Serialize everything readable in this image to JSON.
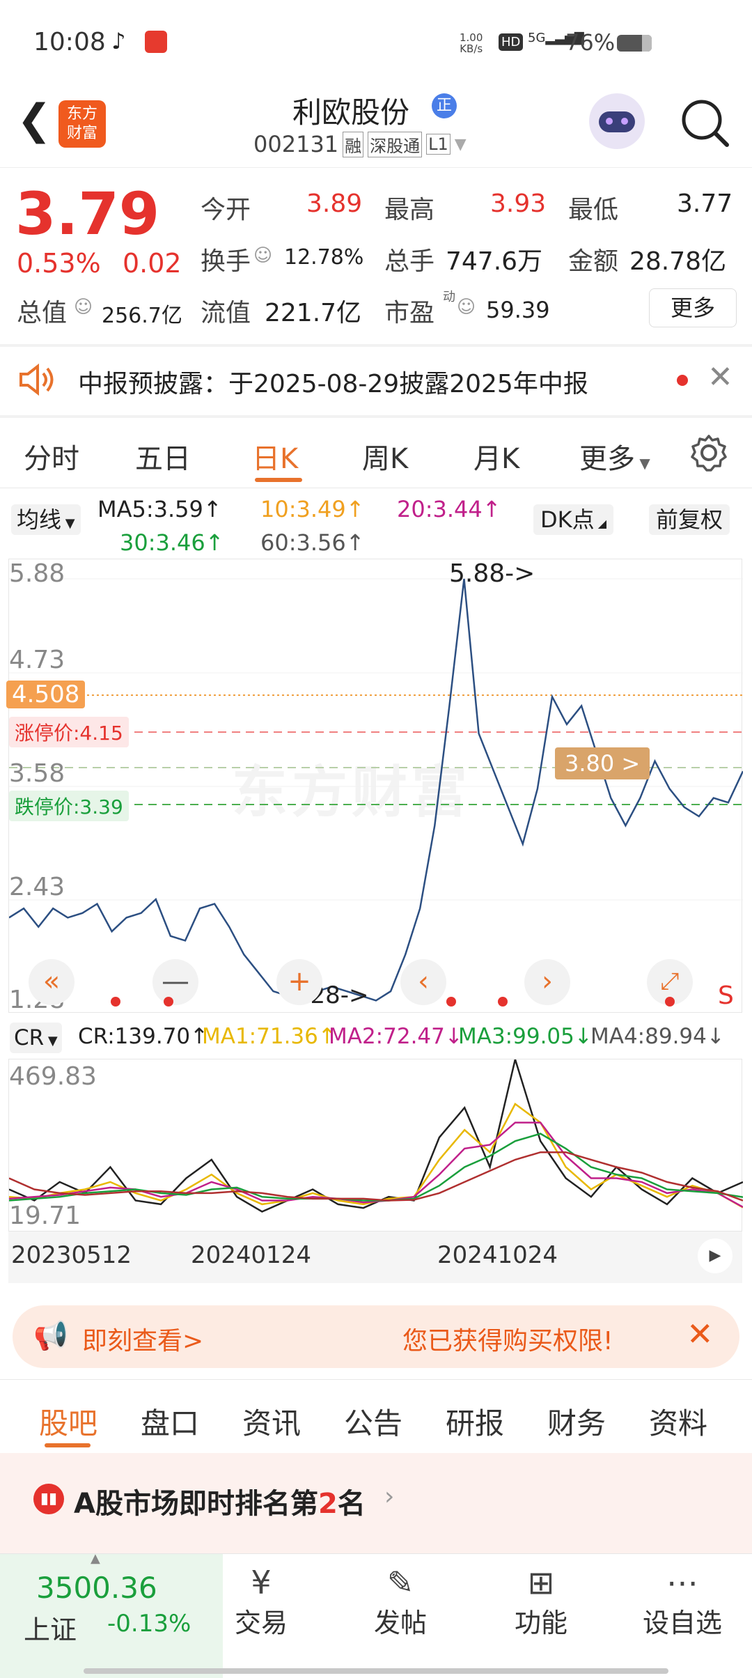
{
  "status": {
    "time": "10:08",
    "net_speed": "1.00",
    "net_unit": "KB/s",
    "hd": "HD",
    "signal": "5G",
    "battery": "76%"
  },
  "header": {
    "logo_line1": "东方",
    "logo_line2": "财富",
    "stock_name": "利欧股份",
    "badge": "正",
    "stock_code": "002131",
    "tag1": "融",
    "tag2": "深股通",
    "tag3": "L1"
  },
  "quote": {
    "price": "3.79",
    "change_pct": "0.53%",
    "change_abs": "0.02",
    "open_label": "今开",
    "open": "3.89",
    "high_label": "最高",
    "high": "3.93",
    "low_label": "最低",
    "low": "3.77",
    "turnover_label": "换手",
    "turnover": "12.78%",
    "volume_label": "总手",
    "volume": "747.6万",
    "amount_label": "金额",
    "amount": "28.78亿",
    "mktcap_label": "总值",
    "mktcap": "256.7亿",
    "float_label": "流值",
    "float": "221.7亿",
    "pe_label": "市盈",
    "pe_sup": "动",
    "pe": "59.39",
    "more": "更多"
  },
  "notice": {
    "text": "中报预披露：于2025-08-29披露2025年中报"
  },
  "tabs": [
    "分时",
    "五日",
    "日K",
    "周K",
    "月K",
    "更多"
  ],
  "ma": {
    "selector": "均线",
    "ma5": "MA5:3.59↑",
    "ma10": "10:3.49↑",
    "ma20": "20:3.44↑",
    "ma30": "30:3.46↑",
    "ma60": "60:3.56↑",
    "dk": "DK点",
    "fq": "前复权"
  },
  "kchart": {
    "y_labels": [
      "5.88",
      "4.73",
      "3.58",
      "2.43",
      "1.28"
    ],
    "max_label": "5.88->",
    "min_label": "1.28->",
    "s_mark": "S",
    "line_4508": "4.508",
    "limit_up": "涨停价:4.15",
    "limit_down": "跌停价:3.39",
    "cursor": "3.80 >",
    "watermark": "东方财富"
  },
  "chart_data": [
    {
      "type": "line",
      "title": "",
      "ylim": [
        1.28,
        5.88
      ],
      "x": [
        "20230512",
        "20240124",
        "20241024"
      ],
      "series": [
        {
          "values": [
            2.2,
            2.3,
            2.1,
            2.3,
            2.2,
            2.25,
            2.35,
            2.05,
            2.2,
            2.25,
            2.4,
            2.0,
            1.95,
            2.3,
            2.35,
            2.1,
            1.8,
            1.6,
            1.4,
            1.35,
            1.3,
            1.4,
            1.45,
            1.4,
            1.35,
            1.3,
            1.4,
            1.8,
            2.3,
            3.2,
            4.5,
            5.88,
            4.2,
            3.8,
            3.4,
            3.0,
            3.6,
            4.6,
            4.3,
            4.5,
            4.0,
            3.5,
            3.2,
            3.5,
            3.9,
            3.6,
            3.4,
            3.3,
            3.5,
            3.45,
            3.79
          ]
        }
      ]
    },
    {
      "type": "line",
      "title": "",
      "ylim": [
        19.71,
        469.83
      ],
      "series": [
        {
          "name": "CR",
          "values": [
            120,
            90,
            140,
            110,
            180,
            90,
            80,
            150,
            200,
            100,
            60,
            90,
            120,
            80,
            70,
            100,
            90,
            260,
            340,
            180,
            470,
            250,
            150,
            100,
            180,
            120,
            80,
            150,
            110,
            139.7
          ]
        },
        {
          "name": "MA1",
          "values": [
            100,
            95,
            110,
            120,
            140,
            110,
            90,
            120,
            160,
            110,
            80,
            90,
            110,
            90,
            80,
            95,
            100,
            200,
            280,
            220,
            350,
            300,
            180,
            120,
            160,
            130,
            100,
            130,
            110,
            71.36
          ]
        },
        {
          "name": "MA2",
          "values": [
            95,
            100,
            105,
            115,
            125,
            120,
            100,
            110,
            140,
            120,
            90,
            90,
            100,
            95,
            85,
            90,
            100,
            160,
            230,
            240,
            300,
            300,
            210,
            150,
            150,
            140,
            110,
            120,
            110,
            72.47
          ]
        },
        {
          "name": "MA3",
          "values": [
            90,
            95,
            100,
            110,
            115,
            120,
            110,
            105,
            120,
            125,
            100,
            95,
            95,
            95,
            90,
            90,
            95,
            130,
            180,
            210,
            250,
            270,
            230,
            180,
            160,
            150,
            120,
            115,
            110,
            99.05
          ]
        },
        {
          "name": "MA4",
          "values": [
            150,
            120,
            110,
            105,
            110,
            115,
            115,
            110,
            110,
            115,
            110,
            100,
            95,
            95,
            95,
            90,
            92,
            110,
            140,
            170,
            200,
            220,
            220,
            200,
            180,
            165,
            140,
            125,
            115,
            89.94
          ]
        }
      ]
    }
  ],
  "cr": {
    "selector": "CR",
    "cr": "CR:139.70↑",
    "ma1": "MA1:71.36↑",
    "ma2": "MA2:72.47↓",
    "ma3": "MA3:99.05↓",
    "ma4": "MA4:89.94↓",
    "y_top": "469.83",
    "y_bottom": "19.71"
  },
  "xaxis": [
    "20230512",
    "20240124",
    "20241024"
  ],
  "promo": {
    "left": "即刻查看>",
    "right": "您已获得购买权限!"
  },
  "subtabs": [
    "股吧",
    "盘口",
    "资讯",
    "公告",
    "研报",
    "财务",
    "资料"
  ],
  "rank": {
    "prefix": "A股市场即时排名第",
    "num": "2",
    "suffix": "名"
  },
  "bottom": {
    "index_value": "3500.36",
    "index_name": "上证",
    "index_change": "-0.13%",
    "trade": "交易",
    "post": "发帖",
    "func": "功能",
    "watch": "设自选"
  }
}
